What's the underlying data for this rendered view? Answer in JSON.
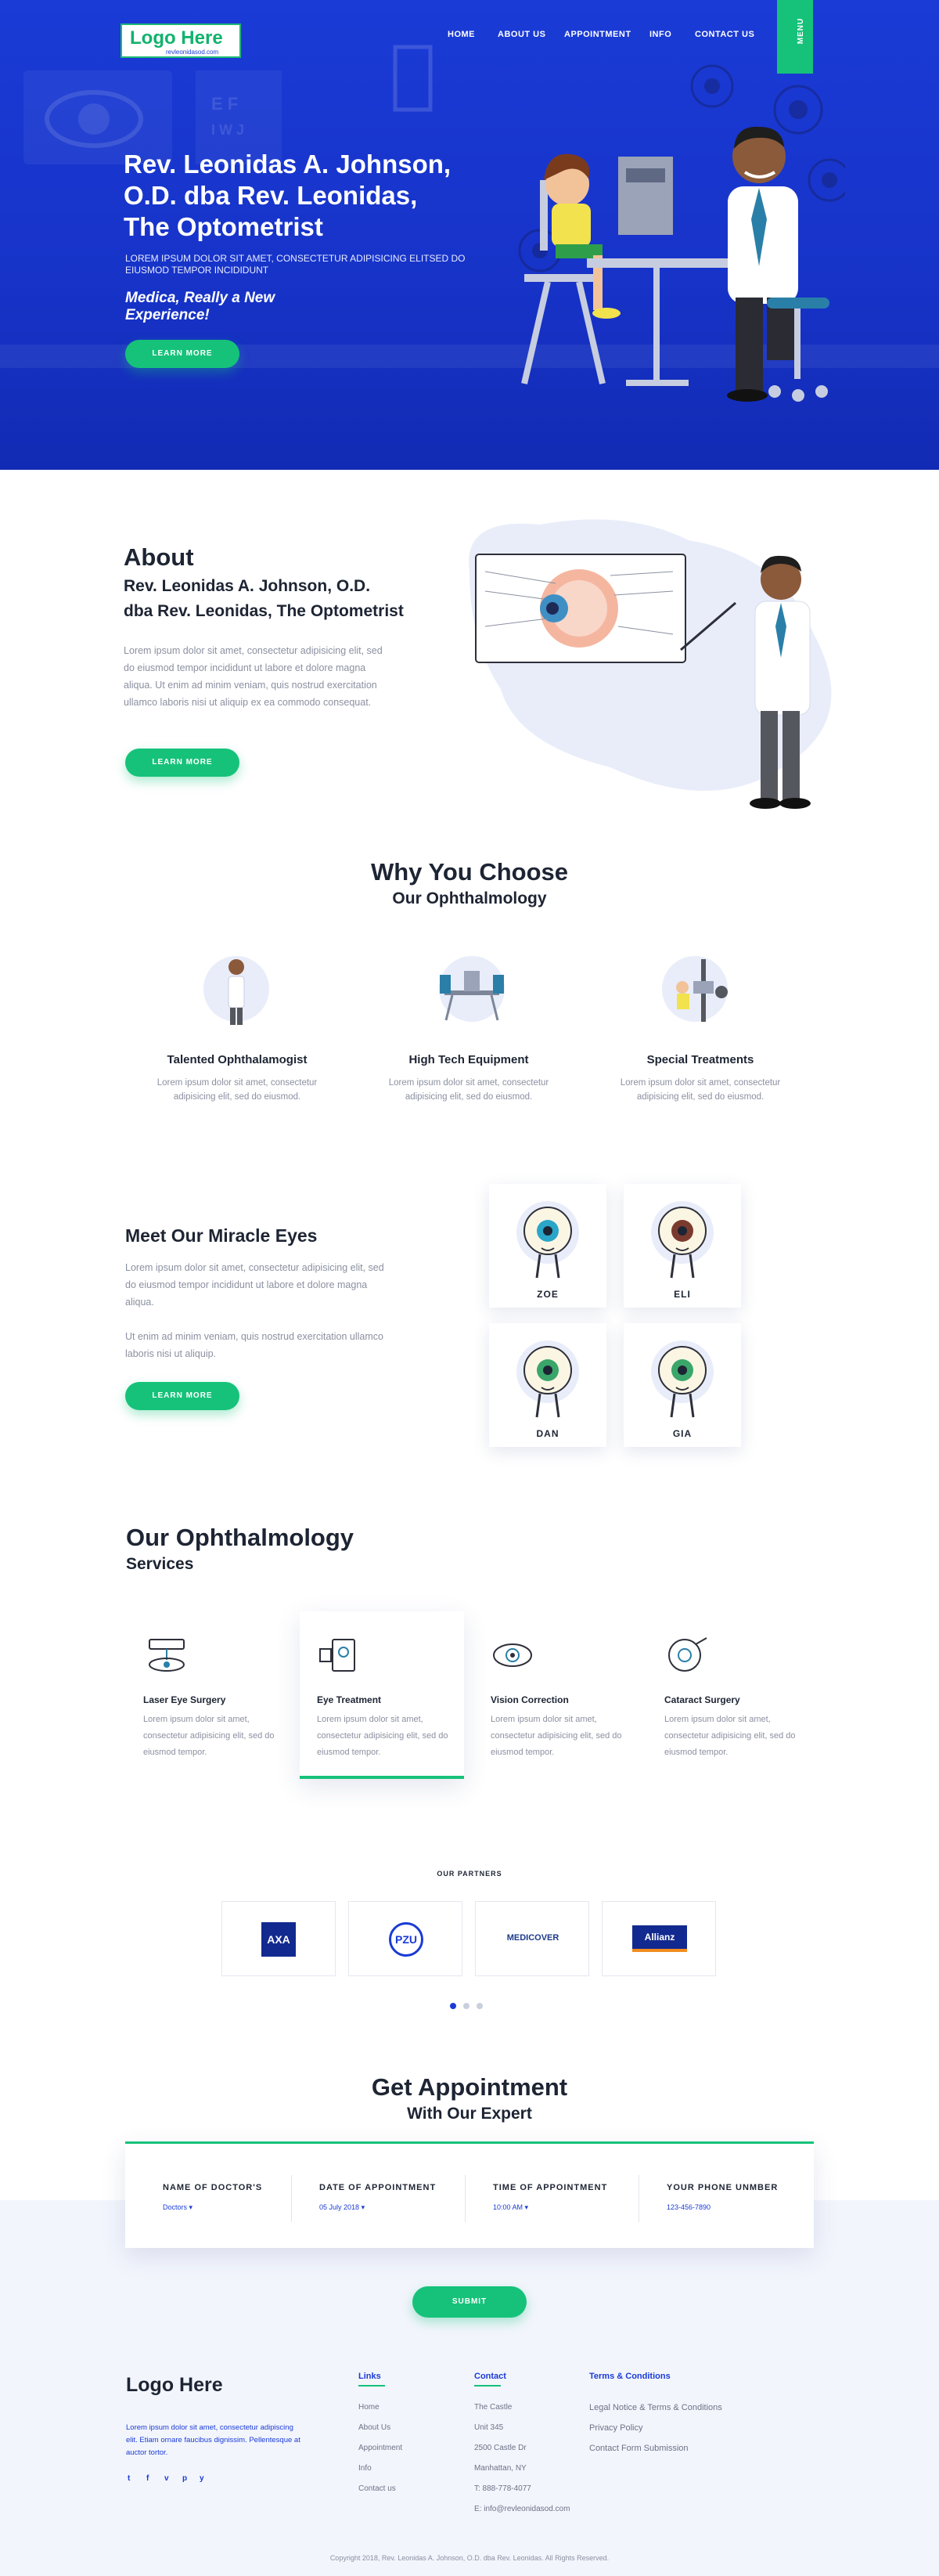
{
  "colors": {
    "brand_blue": "#1a3bd6",
    "accent_green": "#16c27a",
    "text_dark": "#1d2433",
    "text_muted": "#8b90a0"
  },
  "header": {
    "logo_text": "Logo Here",
    "logo_sub": "revleonidasod.com",
    "nav": [
      "HOME",
      "ABOUT US",
      "APPOINTMENT",
      "INFO",
      "CONTACT US"
    ],
    "menu_label": "MENU"
  },
  "hero": {
    "title_lines": [
      "Rev. Leonidas A. Johnson,",
      "O.D. dba Rev. Leonidas,",
      "The Optometrist"
    ],
    "subtitle": "LOREM IPSUM DOLOR SIT AMET, CONSECTETUR ADIPISICING ELITSED DO EIUSMOD TEMPOR INCIDIDUNT",
    "tagline": "Medica, Really a New Experience!",
    "button": "LEARN MORE"
  },
  "about": {
    "heading": "About",
    "subheading_lines": [
      "Rev. Leonidas A. Johnson, O.D.",
      "dba Rev. Leonidas, The Optometrist"
    ],
    "body": "Lorem ipsum dolor sit amet, consectetur adipisicing elit, sed do eiusmod tempor incididunt ut labore et dolore magna aliqua. Ut enim ad minim veniam, quis nostrud exercitation ullamco laboris nisi ut aliquip ex ea commodo consequat.",
    "button": "LEARN MORE"
  },
  "why": {
    "heading": "Why You Choose",
    "subheading": "Our Ophthalmology",
    "features": [
      {
        "title": "Talented Ophthalamogist",
        "desc": "Lorem ipsum dolor sit amet, consectetur adipisicing elit, sed do eiusmod."
      },
      {
        "title": "High Tech Equipment",
        "desc": "Lorem ipsum dolor sit amet, consectetur adipisicing elit, sed do eiusmod."
      },
      {
        "title": "Special Treatments",
        "desc": "Lorem ipsum dolor sit amet, consectetur adipisicing elit, sed do eiusmod."
      }
    ]
  },
  "eyes": {
    "heading": "Meet Our Miracle Eyes",
    "body1": "Lorem ipsum dolor sit amet, consectetur adipisicing elit, sed do eiusmod tempor incididunt ut labore et dolore magna aliqua.",
    "body2": "Ut enim ad minim veniam, quis nostrud exercitation ullamco laboris nisi ut aliquip.",
    "button": "LEARN MORE",
    "cards": [
      {
        "name": "ZOE",
        "iris": "#2aa6c9"
      },
      {
        "name": "ELI",
        "iris": "#7a3b2e"
      },
      {
        "name": "DAN",
        "iris": "#3aa66a"
      },
      {
        "name": "GIA",
        "iris": "#3aa66a"
      }
    ]
  },
  "services": {
    "heading": "Our Ophthalmology",
    "subheading": "Services",
    "items": [
      {
        "title": "Laser Eye Surgery",
        "desc": "Lorem ipsum dolor sit amet, consectetur adipisicing elit, sed do eiusmod tempor.",
        "icon": "laser-icon"
      },
      {
        "title": "Eye Treatment",
        "desc": "Lorem ipsum dolor sit amet, consectetur adipisicing elit, sed do eiusmod tempor.",
        "icon": "treatment-icon"
      },
      {
        "title": "Vision Correction",
        "desc": "Lorem ipsum dolor sit amet, consectetur adipisicing elit, sed do eiusmod tempor.",
        "icon": "vision-icon"
      },
      {
        "title": "Cataract Surgery",
        "desc": "Lorem ipsum dolor sit amet, consectetur adipisicing elit, sed do eiusmod tempor.",
        "icon": "cataract-icon"
      }
    ]
  },
  "partners": {
    "heading": "OUR PARTNERS",
    "logos": [
      "AXA",
      "PZU",
      "MEDICOVER",
      "Allianz"
    ]
  },
  "appointment": {
    "heading": "Get Appointment",
    "subheading": "With Our Expert",
    "fields": [
      {
        "label": "NAME OF DOCTOR'S",
        "value": "Doctors"
      },
      {
        "label": "DATE OF APPOINTMENT",
        "value": "05 July 2018"
      },
      {
        "label": "TIME OF APPOINTMENT",
        "value": "10:00 AM"
      },
      {
        "label": "YOUR PHONE UNMBER",
        "value": "123-456-7890"
      }
    ],
    "submit": "SUBMIT"
  },
  "footer": {
    "logo": "Logo Here",
    "about": "Lorem ipsum dolor sit amet, consectetur adipiscing elit. Etiam ornare faucibus dignissim. Pellentesque at auctor tortor.",
    "social": [
      "t",
      "f",
      "v",
      "p",
      "y"
    ],
    "links_heading": "Links",
    "links": [
      "Home",
      "About Us",
      "Appointment",
      "Info",
      "Contact us"
    ],
    "contact_heading": "Contact",
    "contact": [
      "The Castle",
      "Unit 345",
      "2500 Castle Dr",
      "Manhattan, NY",
      "T: 888-778-4077",
      "E: info@revleonidasod.com"
    ],
    "terms_heading": "Terms & Conditions",
    "terms": [
      "Legal Notice & Terms & Conditions",
      "Privacy Policy",
      "Contact Form Submission"
    ],
    "copyright": "Copyright 2018, Rev. Leonidas A. Johnson, O.D. dba Rev. Leonidas. All Rights Reserved."
  }
}
